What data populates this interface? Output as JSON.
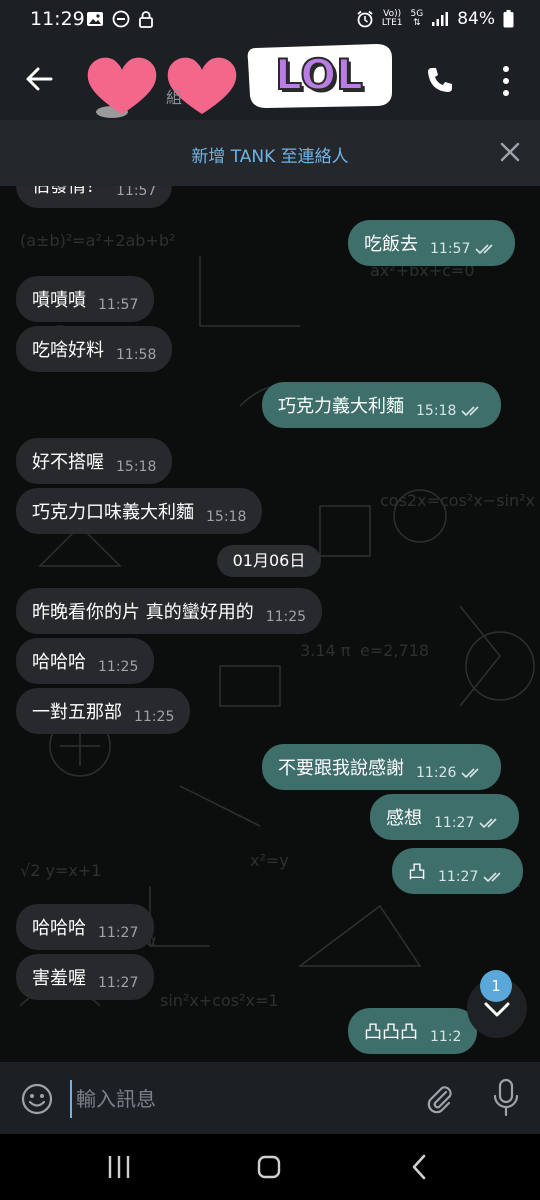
{
  "status_bar": {
    "time": "11:29",
    "volte": "Vo))",
    "lte": "LTE1",
    "network": "5G",
    "battery": "84%"
  },
  "header": {
    "subtitle": "組",
    "sticker_text": "LOL"
  },
  "add_contact_bar": {
    "label": "新增 TANK 至連絡人"
  },
  "date_chip": "01月06日",
  "messages": [
    {
      "dir": "in",
      "text": "佔發情？",
      "time": "11:57"
    },
    {
      "dir": "out",
      "text": "吃飯去",
      "time": "11:57"
    },
    {
      "dir": "in",
      "text": "嘖嘖嘖",
      "time": "11:57"
    },
    {
      "dir": "in",
      "text": "吃啥好料",
      "time": "11:58"
    },
    {
      "dir": "out",
      "text": "巧克力義大利麵",
      "time": "15:18"
    },
    {
      "dir": "in",
      "text": "好不搭喔",
      "time": "15:18"
    },
    {
      "dir": "in",
      "text": "巧克力口味義大利麵",
      "time": "15:18"
    },
    {
      "dir": "in",
      "text": "昨晚看你的片 真的蠻好用的",
      "time": "11:25"
    },
    {
      "dir": "in",
      "text": "哈哈哈",
      "time": "11:25"
    },
    {
      "dir": "in",
      "text": "一對五那部",
      "time": "11:25"
    },
    {
      "dir": "out",
      "text": "不要跟我說感謝",
      "time": "11:26"
    },
    {
      "dir": "out",
      "text": "感想",
      "time": "11:27"
    },
    {
      "dir": "out",
      "text": "凸",
      "time": "11:27"
    },
    {
      "dir": "in",
      "text": "哈哈哈",
      "time": "11:27"
    },
    {
      "dir": "in",
      "text": "害羞喔",
      "time": "11:27"
    },
    {
      "dir": "out",
      "text": "凸凸凸",
      "time": "11:2"
    }
  ],
  "unread_badge": "1",
  "input": {
    "placeholder": "輸入訊息"
  },
  "colors": {
    "bar_bg": "#1c1f24",
    "incoming": "#27292c",
    "outgoing": "#3e6f6b",
    "accent": "#6fb3e3"
  },
  "icons": [
    "back-arrow-icon",
    "phone-icon",
    "more-vert-icon",
    "close-icon",
    "emoji-icon",
    "attach-icon",
    "mic-icon",
    "chevron-down-icon"
  ]
}
